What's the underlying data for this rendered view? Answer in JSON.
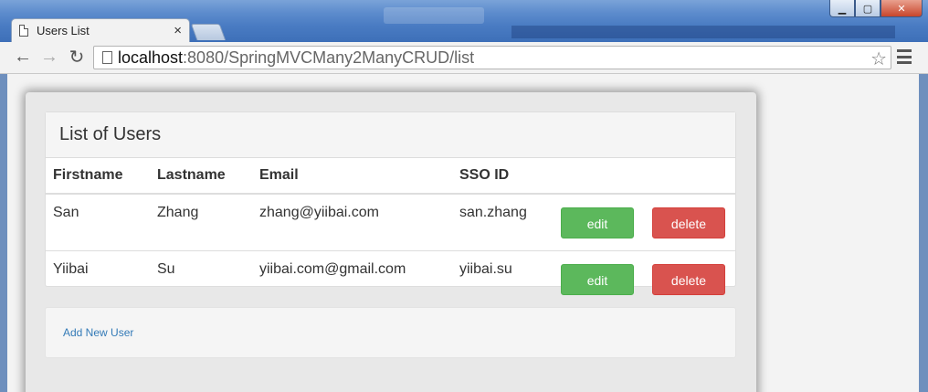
{
  "window": {
    "tab_title": "Users List",
    "tab_close": "×",
    "controls": {
      "minimize": "▁",
      "maximize": "▢",
      "close": "✕"
    }
  },
  "toolbar": {
    "back": "←",
    "forward": "→",
    "reload": "↻",
    "url_host": "localhost",
    "url_rest": ":8080/SpringMVCMany2ManyCRUD/list",
    "star": "☆"
  },
  "page": {
    "panel_title": "List of Users",
    "columns": [
      "Firstname",
      "Lastname",
      "Email",
      "SSO ID"
    ],
    "rows": [
      {
        "firstname": "San",
        "lastname": "Zhang",
        "email": "zhang@yiibai.com",
        "sso_id": "san.zhang",
        "edit": "edit",
        "delete": "delete"
      },
      {
        "firstname": "Yiibai",
        "lastname": "Su",
        "email": "yiibai.com@gmail.com",
        "sso_id": "yiibai.su",
        "edit": "edit",
        "delete": "delete"
      }
    ],
    "add_link": "Add New User"
  },
  "colors": {
    "edit": "#5cb85c",
    "delete": "#d9534f",
    "link": "#337ab7"
  }
}
